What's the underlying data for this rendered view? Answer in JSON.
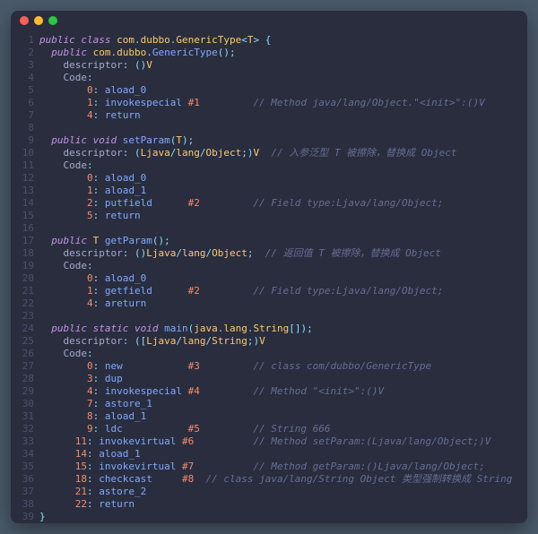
{
  "window": {
    "traffic_lights": [
      "close",
      "minimize",
      "zoom"
    ]
  },
  "lines": [
    {
      "n": 1,
      "ind": 0,
      "segs": [
        {
          "c": "kw",
          "t": "public "
        },
        {
          "c": "kw",
          "t": "class "
        },
        {
          "c": "typ",
          "t": "com"
        },
        {
          "c": "pun",
          "t": "."
        },
        {
          "c": "typ",
          "t": "dubbo"
        },
        {
          "c": "pun",
          "t": "."
        },
        {
          "c": "typ",
          "t": "GenericType"
        },
        {
          "c": "pun",
          "t": "<"
        },
        {
          "c": "typ",
          "t": "T"
        },
        {
          "c": "pun",
          "t": "> {"
        }
      ]
    },
    {
      "n": 2,
      "ind": 1,
      "segs": [
        {
          "c": "kw",
          "t": "public "
        },
        {
          "c": "typ",
          "t": "com"
        },
        {
          "c": "pun",
          "t": "."
        },
        {
          "c": "typ",
          "t": "dubbo"
        },
        {
          "c": "pun",
          "t": "."
        },
        {
          "c": "fn",
          "t": "GenericType"
        },
        {
          "c": "pun",
          "t": "();"
        }
      ]
    },
    {
      "n": 3,
      "ind": 2,
      "segs": [
        {
          "c": "def",
          "t": "descriptor"
        },
        {
          "c": "pun",
          "t": ": ()"
        },
        {
          "c": "typ",
          "t": "V"
        }
      ]
    },
    {
      "n": 4,
      "ind": 2,
      "segs": [
        {
          "c": "def",
          "t": "Code"
        },
        {
          "c": "pun",
          "t": ":"
        }
      ]
    },
    {
      "n": 5,
      "ind": 4,
      "segs": [
        {
          "c": "num",
          "t": "0"
        },
        {
          "c": "pun",
          "t": ": "
        },
        {
          "c": "opn",
          "t": "aload_0"
        }
      ]
    },
    {
      "n": 6,
      "ind": 4,
      "segs": [
        {
          "c": "num",
          "t": "1"
        },
        {
          "c": "pun",
          "t": ": "
        },
        {
          "c": "opn",
          "t": "invokespecial "
        },
        {
          "c": "num",
          "t": "#1"
        }
      ],
      "cmt": "// Method java/lang/Object.\"<init>\":()V",
      "cmtcol": 36
    },
    {
      "n": 7,
      "ind": 4,
      "segs": [
        {
          "c": "num",
          "t": "4"
        },
        {
          "c": "pun",
          "t": ": "
        },
        {
          "c": "opn",
          "t": "return"
        }
      ]
    },
    {
      "n": 8,
      "ind": 0,
      "segs": []
    },
    {
      "n": 9,
      "ind": 1,
      "segs": [
        {
          "c": "kw",
          "t": "public "
        },
        {
          "c": "kw",
          "t": "void "
        },
        {
          "c": "fn",
          "t": "setParam"
        },
        {
          "c": "pun",
          "t": "("
        },
        {
          "c": "typ",
          "t": "T"
        },
        {
          "c": "pun",
          "t": ");"
        }
      ]
    },
    {
      "n": 10,
      "ind": 2,
      "segs": [
        {
          "c": "def",
          "t": "descriptor"
        },
        {
          "c": "pun",
          "t": ": ("
        },
        {
          "c": "typ",
          "t": "Ljava"
        },
        {
          "c": "pun",
          "t": "/"
        },
        {
          "c": "typ",
          "t": "lang"
        },
        {
          "c": "pun",
          "t": "/"
        },
        {
          "c": "typ",
          "t": "Object"
        },
        {
          "c": "pun",
          "t": ";)"
        },
        {
          "c": "typ",
          "t": "V"
        }
      ],
      "cmt": "// 入参泛型 T 被擦除，替换成 Object",
      "cmtcol": 36
    },
    {
      "n": 11,
      "ind": 2,
      "segs": [
        {
          "c": "def",
          "t": "Code"
        },
        {
          "c": "pun",
          "t": ":"
        }
      ]
    },
    {
      "n": 12,
      "ind": 4,
      "segs": [
        {
          "c": "num",
          "t": "0"
        },
        {
          "c": "pun",
          "t": ": "
        },
        {
          "c": "opn",
          "t": "aload_0"
        }
      ]
    },
    {
      "n": 13,
      "ind": 4,
      "segs": [
        {
          "c": "num",
          "t": "1"
        },
        {
          "c": "pun",
          "t": ": "
        },
        {
          "c": "opn",
          "t": "aload_1"
        }
      ]
    },
    {
      "n": 14,
      "ind": 4,
      "segs": [
        {
          "c": "num",
          "t": "2"
        },
        {
          "c": "pun",
          "t": ": "
        },
        {
          "c": "opn",
          "t": "putfield      "
        },
        {
          "c": "num",
          "t": "#2"
        }
      ],
      "cmt": "// Field type:Ljava/lang/Object;",
      "cmtcol": 36
    },
    {
      "n": 15,
      "ind": 4,
      "segs": [
        {
          "c": "num",
          "t": "5"
        },
        {
          "c": "pun",
          "t": ": "
        },
        {
          "c": "opn",
          "t": "return"
        }
      ]
    },
    {
      "n": 16,
      "ind": 0,
      "segs": []
    },
    {
      "n": 17,
      "ind": 1,
      "segs": [
        {
          "c": "kw",
          "t": "public "
        },
        {
          "c": "typ",
          "t": "T "
        },
        {
          "c": "fn",
          "t": "getParam"
        },
        {
          "c": "pun",
          "t": "();"
        }
      ]
    },
    {
      "n": 18,
      "ind": 2,
      "segs": [
        {
          "c": "def",
          "t": "descriptor"
        },
        {
          "c": "pun",
          "t": ": ()"
        },
        {
          "c": "typ",
          "t": "Ljava"
        },
        {
          "c": "pun",
          "t": "/"
        },
        {
          "c": "typ",
          "t": "lang"
        },
        {
          "c": "pun",
          "t": "/"
        },
        {
          "c": "typ",
          "t": "Object"
        },
        {
          "c": "pun",
          "t": ";"
        }
      ],
      "cmt": "// 返回值 T 被擦除，替换成 Object",
      "cmtcol": 36
    },
    {
      "n": 19,
      "ind": 2,
      "segs": [
        {
          "c": "def",
          "t": "Code"
        },
        {
          "c": "pun",
          "t": ":"
        }
      ]
    },
    {
      "n": 20,
      "ind": 4,
      "segs": [
        {
          "c": "num",
          "t": "0"
        },
        {
          "c": "pun",
          "t": ": "
        },
        {
          "c": "opn",
          "t": "aload_0"
        }
      ]
    },
    {
      "n": 21,
      "ind": 4,
      "segs": [
        {
          "c": "num",
          "t": "1"
        },
        {
          "c": "pun",
          "t": ": "
        },
        {
          "c": "opn",
          "t": "getfield      "
        },
        {
          "c": "num",
          "t": "#2"
        }
      ],
      "cmt": "// Field type:Ljava/lang/Object;",
      "cmtcol": 36
    },
    {
      "n": 22,
      "ind": 4,
      "segs": [
        {
          "c": "num",
          "t": "4"
        },
        {
          "c": "pun",
          "t": ": "
        },
        {
          "c": "opn",
          "t": "areturn"
        }
      ]
    },
    {
      "n": 23,
      "ind": 0,
      "segs": []
    },
    {
      "n": 24,
      "ind": 1,
      "segs": [
        {
          "c": "kw",
          "t": "public "
        },
        {
          "c": "kw",
          "t": "static "
        },
        {
          "c": "kw",
          "t": "void "
        },
        {
          "c": "fn",
          "t": "main"
        },
        {
          "c": "pun",
          "t": "("
        },
        {
          "c": "typ",
          "t": "java"
        },
        {
          "c": "pun",
          "t": "."
        },
        {
          "c": "typ",
          "t": "lang"
        },
        {
          "c": "pun",
          "t": "."
        },
        {
          "c": "typ",
          "t": "String"
        },
        {
          "c": "pun",
          "t": "[]);"
        }
      ]
    },
    {
      "n": 25,
      "ind": 2,
      "segs": [
        {
          "c": "def",
          "t": "descriptor"
        },
        {
          "c": "pun",
          "t": ": (["
        },
        {
          "c": "typ",
          "t": "Ljava"
        },
        {
          "c": "pun",
          "t": "/"
        },
        {
          "c": "typ",
          "t": "lang"
        },
        {
          "c": "pun",
          "t": "/"
        },
        {
          "c": "typ",
          "t": "String"
        },
        {
          "c": "pun",
          "t": ";)"
        },
        {
          "c": "typ",
          "t": "V"
        }
      ]
    },
    {
      "n": 26,
      "ind": 2,
      "segs": [
        {
          "c": "def",
          "t": "Code"
        },
        {
          "c": "pun",
          "t": ":"
        }
      ]
    },
    {
      "n": 27,
      "ind": 4,
      "segs": [
        {
          "c": "num",
          "t": "0"
        },
        {
          "c": "pun",
          "t": ": "
        },
        {
          "c": "opn",
          "t": "new           "
        },
        {
          "c": "num",
          "t": "#3"
        }
      ],
      "cmt": "// class com/dubbo/GenericType",
      "cmtcol": 36
    },
    {
      "n": 28,
      "ind": 4,
      "segs": [
        {
          "c": "num",
          "t": "3"
        },
        {
          "c": "pun",
          "t": ": "
        },
        {
          "c": "opn",
          "t": "dup"
        }
      ]
    },
    {
      "n": 29,
      "ind": 4,
      "segs": [
        {
          "c": "num",
          "t": "4"
        },
        {
          "c": "pun",
          "t": ": "
        },
        {
          "c": "opn",
          "t": "invokespecial "
        },
        {
          "c": "num",
          "t": "#4"
        }
      ],
      "cmt": "// Method \"<init>\":()V",
      "cmtcol": 36
    },
    {
      "n": 30,
      "ind": 4,
      "segs": [
        {
          "c": "num",
          "t": "7"
        },
        {
          "c": "pun",
          "t": ": "
        },
        {
          "c": "opn",
          "t": "astore_1"
        }
      ]
    },
    {
      "n": 31,
      "ind": 4,
      "segs": [
        {
          "c": "num",
          "t": "8"
        },
        {
          "c": "pun",
          "t": ": "
        },
        {
          "c": "opn",
          "t": "aload_1"
        }
      ]
    },
    {
      "n": 32,
      "ind": 4,
      "segs": [
        {
          "c": "num",
          "t": "9"
        },
        {
          "c": "pun",
          "t": ": "
        },
        {
          "c": "opn",
          "t": "ldc           "
        },
        {
          "c": "num",
          "t": "#5"
        }
      ],
      "cmt": "// String 666",
      "cmtcol": 36
    },
    {
      "n": 33,
      "ind": 3,
      "segs": [
        {
          "c": "num",
          "t": "11"
        },
        {
          "c": "pun",
          "t": ": "
        },
        {
          "c": "opn",
          "t": "invokevirtual "
        },
        {
          "c": "num",
          "t": "#6"
        }
      ],
      "cmt": "// Method setParam:(Ljava/lang/Object;)V",
      "cmtcol": 36
    },
    {
      "n": 34,
      "ind": 3,
      "segs": [
        {
          "c": "num",
          "t": "14"
        },
        {
          "c": "pun",
          "t": ": "
        },
        {
          "c": "opn",
          "t": "aload_1"
        }
      ]
    },
    {
      "n": 35,
      "ind": 3,
      "segs": [
        {
          "c": "num",
          "t": "15"
        },
        {
          "c": "pun",
          "t": ": "
        },
        {
          "c": "opn",
          "t": "invokevirtual "
        },
        {
          "c": "num",
          "t": "#7"
        }
      ],
      "cmt": "// Method getParam:()Ljava/lang/Object;",
      "cmtcol": 36
    },
    {
      "n": 36,
      "ind": 3,
      "segs": [
        {
          "c": "num",
          "t": "18"
        },
        {
          "c": "pun",
          "t": ": "
        },
        {
          "c": "opn",
          "t": "checkcast     "
        },
        {
          "c": "num",
          "t": "#8"
        }
      ],
      "cmt": "// class java/lang/String Object 类型强制转换成 String",
      "cmtcol": 28
    },
    {
      "n": 37,
      "ind": 3,
      "segs": [
        {
          "c": "num",
          "t": "21"
        },
        {
          "c": "pun",
          "t": ": "
        },
        {
          "c": "opn",
          "t": "astore_2"
        }
      ]
    },
    {
      "n": 38,
      "ind": 3,
      "segs": [
        {
          "c": "num",
          "t": "22"
        },
        {
          "c": "pun",
          "t": ": "
        },
        {
          "c": "opn",
          "t": "return"
        }
      ]
    },
    {
      "n": 39,
      "ind": 0,
      "segs": [
        {
          "c": "pun",
          "t": "}"
        }
      ]
    }
  ]
}
